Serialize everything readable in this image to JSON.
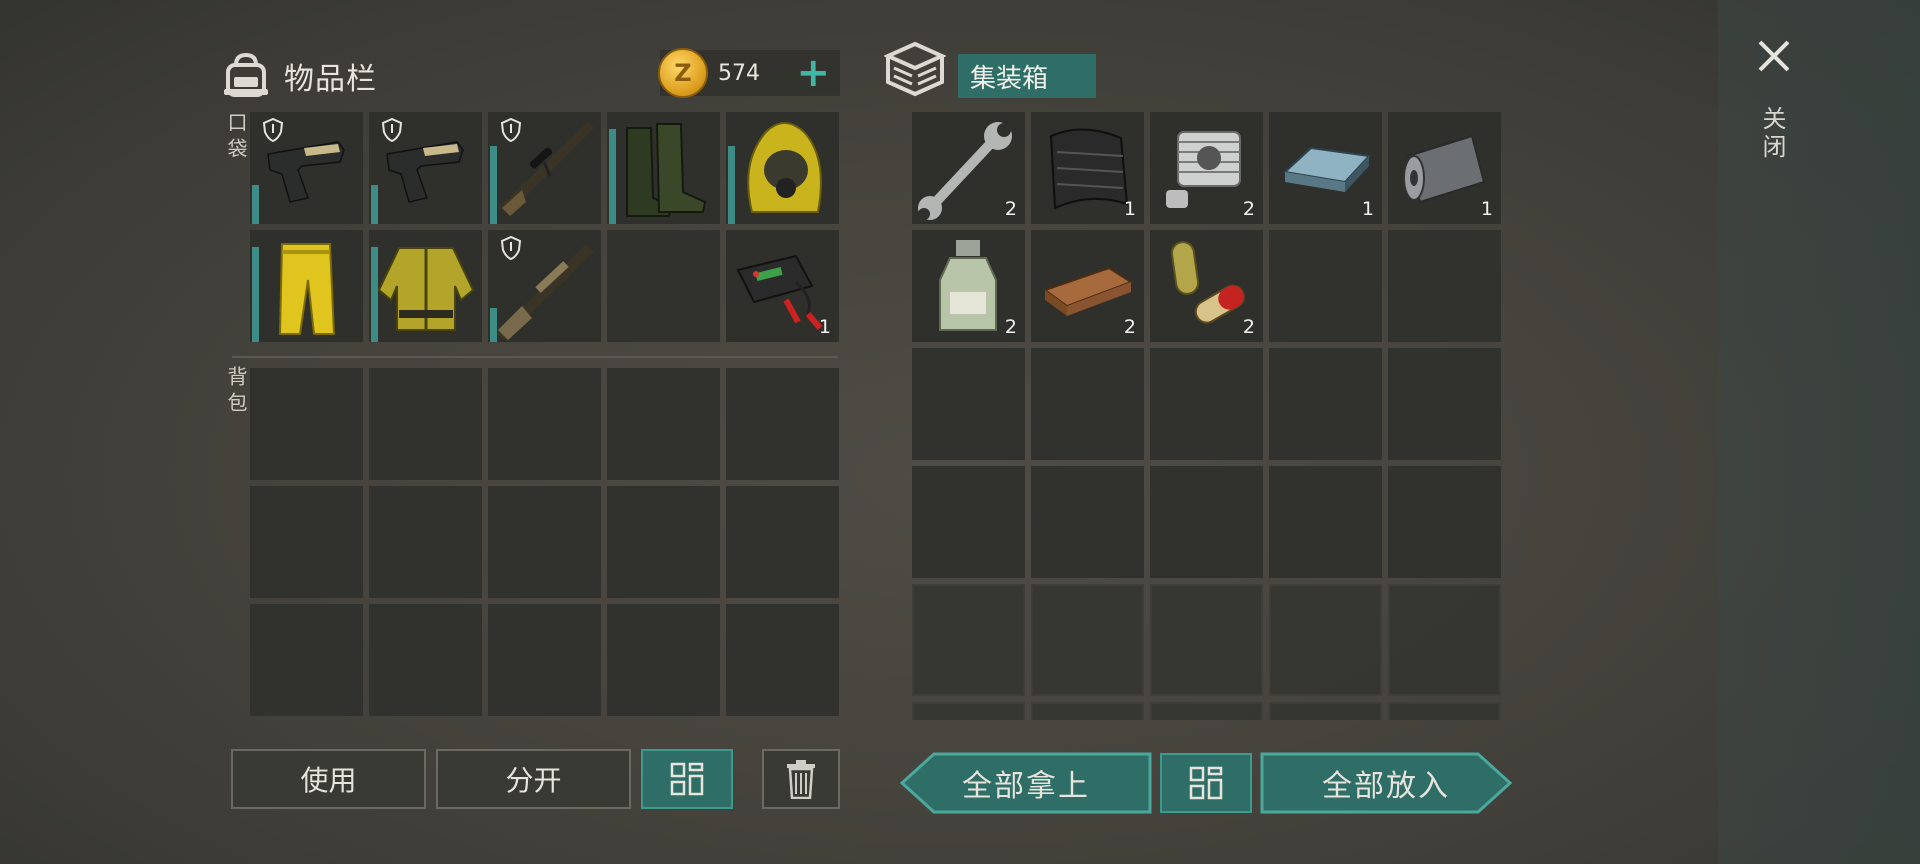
{
  "inventory": {
    "title": "物品栏",
    "coins": "574",
    "pocket_label": "口袋",
    "backpack_label": "背包",
    "pocket_items": [
      {
        "name": "pistol",
        "icon": "pistol-icon",
        "locked": true,
        "durability": 0.35,
        "qty": ""
      },
      {
        "name": "pistol",
        "icon": "pistol-icon",
        "locked": true,
        "durability": 0.35,
        "qty": ""
      },
      {
        "name": "sniper-rifle",
        "icon": "sniper-rifle-icon",
        "locked": true,
        "durability": 0.7,
        "qty": ""
      },
      {
        "name": "rubber-boots",
        "icon": "boots-icon",
        "locked": false,
        "durability": 0.85,
        "qty": ""
      },
      {
        "name": "hazmat-hood",
        "icon": "hazmat-hood-icon",
        "locked": false,
        "durability": 0.7,
        "qty": ""
      },
      {
        "name": "hazmat-pants",
        "icon": "hazmat-pants-icon",
        "locked": false,
        "durability": 0.85,
        "qty": ""
      },
      {
        "name": "hazmat-jacket",
        "icon": "hazmat-jacket-icon",
        "locked": false,
        "durability": 0.85,
        "qty": ""
      },
      {
        "name": "shotgun",
        "icon": "shotgun-icon",
        "locked": true,
        "durability": 0.3,
        "qty": ""
      },
      {
        "name": "empty",
        "icon": "",
        "locked": false,
        "durability": 0,
        "qty": ""
      },
      {
        "name": "car-battery",
        "icon": "car-battery-icon",
        "locked": false,
        "durability": 0,
        "qty": "1"
      }
    ],
    "buttons": {
      "use": "使用",
      "split": "分开"
    }
  },
  "container": {
    "title": "集装箱",
    "items": [
      {
        "name": "wrench",
        "icon": "wrench-icon",
        "qty": "2"
      },
      {
        "name": "carbon-fabric",
        "icon": "carbon-fabric-icon",
        "qty": "1"
      },
      {
        "name": "engine-cylinder",
        "icon": "engine-cylinder-icon",
        "qty": "2"
      },
      {
        "name": "steel-ingot",
        "icon": "steel-ingot-icon",
        "qty": "1"
      },
      {
        "name": "tarp-roll",
        "icon": "tarp-roll-icon",
        "qty": "1"
      },
      {
        "name": "chemical-bottle",
        "icon": "bottle-icon",
        "qty": "2"
      },
      {
        "name": "wood-plank",
        "icon": "wood-plank-icon",
        "qty": "2"
      },
      {
        "name": "pills",
        "icon": "pills-icon",
        "qty": "2"
      }
    ],
    "buttons": {
      "take_all": "全部拿上",
      "put_all": "全部放入"
    }
  },
  "close_label": "关闭",
  "colors": {
    "accent_teal": "#2f6e66",
    "accent_teal_bright": "#3fb6a6",
    "coin_gold": "#e0a322"
  }
}
